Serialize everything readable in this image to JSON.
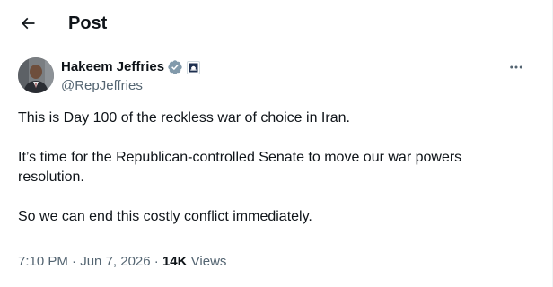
{
  "header": {
    "title": "Post",
    "back_icon": "arrow-left-icon"
  },
  "author": {
    "name": "Hakeem Jeffries",
    "handle": "@RepJeffries",
    "verified_color": "#829aab",
    "affiliation_icon": "us-capitol-icon"
  },
  "tweet": {
    "paragraphs": [
      "This is Day 100 of the reckless war of choice in Iran.",
      "It’s time for the Republican-controlled Senate to move our war powers resolution.",
      "So we can end this costly conflict immediately."
    ]
  },
  "meta": {
    "time": "7:10 PM",
    "separator": "·",
    "date": "Jun 7, 2026",
    "views_count": "14K",
    "views_label": "Views"
  },
  "colors": {
    "text_primary": "#0f1419",
    "text_secondary": "#536471"
  }
}
